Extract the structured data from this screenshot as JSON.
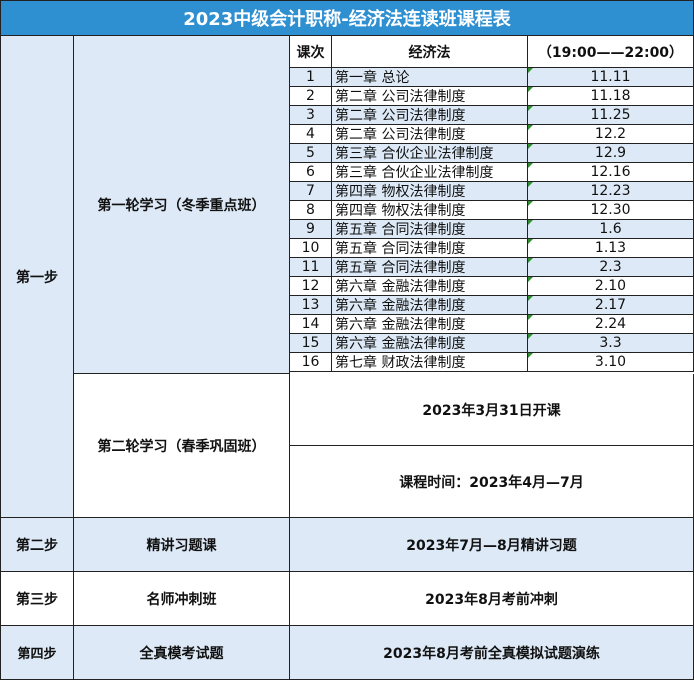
{
  "title": "2023中级会计职称-经济法连读班课程表",
  "header": {
    "col_no": "课次",
    "col_subject": "经济法",
    "col_time": "（19:00——22:00）"
  },
  "sessions": [
    {
      "no": "1",
      "chapter": "第一章 总论",
      "date": "11.11"
    },
    {
      "no": "2",
      "chapter": "第二章 公司法律制度",
      "date": "11.18"
    },
    {
      "no": "3",
      "chapter": "第二章 公司法律制度",
      "date": "11.25"
    },
    {
      "no": "4",
      "chapter": "第二章 公司法律制度",
      "date": "12.2"
    },
    {
      "no": "5",
      "chapter": "第三章 合伙企业法律制度",
      "date": "12.9"
    },
    {
      "no": "6",
      "chapter": "第三章 合伙企业法律制度",
      "date": "12.16"
    },
    {
      "no": "7",
      "chapter": "第四章 物权法律制度",
      "date": "12.23"
    },
    {
      "no": "8",
      "chapter": "第四章 物权法律制度",
      "date": "12.30"
    },
    {
      "no": "9",
      "chapter": "第五章 合同法律制度",
      "date": "1.6"
    },
    {
      "no": "10",
      "chapter": "第五章 合同法律制度",
      "date": "1.13"
    },
    {
      "no": "11",
      "chapter": "第五章 合同法律制度",
      "date": "2.3"
    },
    {
      "no": "12",
      "chapter": "第六章 金融法律制度",
      "date": "2.10"
    },
    {
      "no": "13",
      "chapter": "第六章 金融法律制度",
      "date": "2.17"
    },
    {
      "no": "14",
      "chapter": "第六章 金融法律制度",
      "date": "2.24"
    },
    {
      "no": "15",
      "chapter": "第六章 金融法律制度",
      "date": "3.3"
    },
    {
      "no": "16",
      "chapter": "第七章 财政法律制度",
      "date": "3.10"
    }
  ],
  "step1": {
    "label": "第一步",
    "round1": "第一轮学习（冬季重点班）",
    "round2": "第二轮学习（春季巩固班）",
    "round2_start": "2023年3月31日开课",
    "round2_time": "课程时间：2023年4月—7月"
  },
  "step2": {
    "label": "第二步",
    "name": "精讲习题课",
    "desc": "2023年7月—8月精讲习题"
  },
  "step3": {
    "label": "第三步",
    "name": "名师冲刺班",
    "desc": "2023年8月考前冲刺"
  },
  "step4": {
    "label": "第四步",
    "name": "全真模考试题",
    "desc": "2023年8月考前全真模拟试题演练"
  },
  "colors": {
    "title_bg": "#2e8fd1",
    "light_blue": "#dde9f6",
    "corner_mark": "#2f8f2f"
  }
}
